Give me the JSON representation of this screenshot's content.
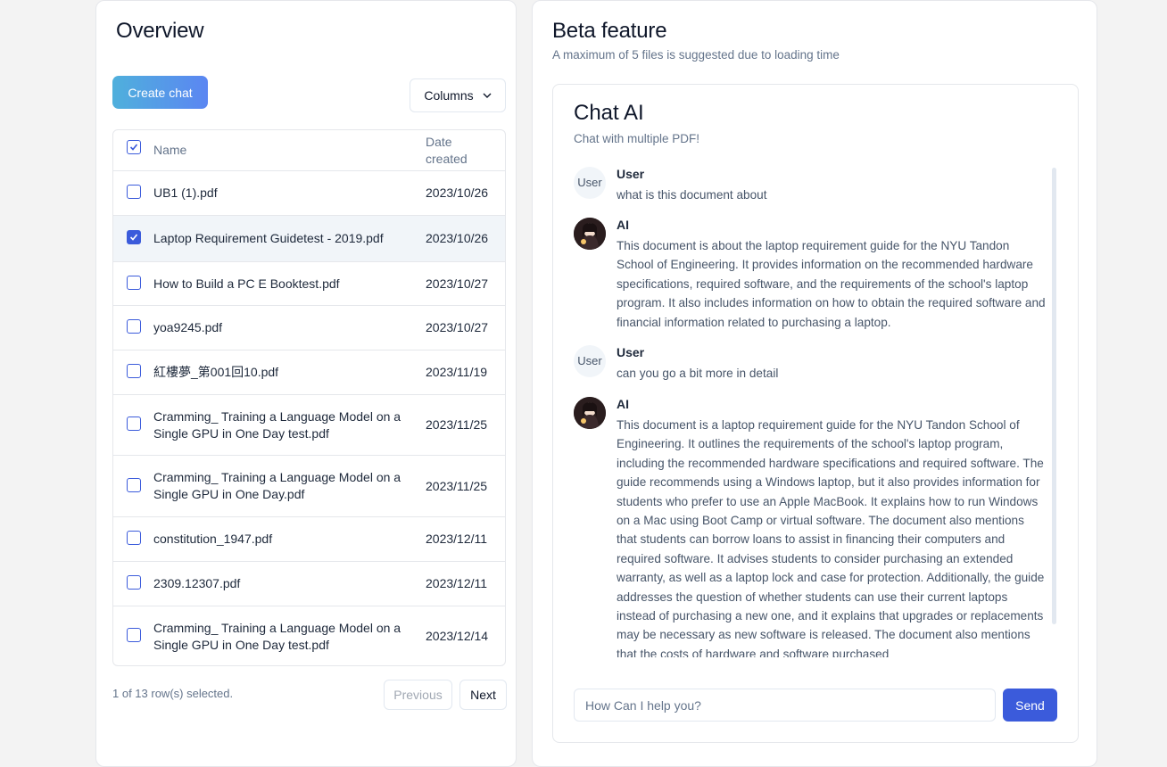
{
  "overview": {
    "title": "Overview",
    "create_chat_label": "Create chat",
    "columns_label": "Columns",
    "table": {
      "headers": {
        "name": "Name",
        "date_line1": "Date",
        "date_line2": "created"
      },
      "rows": [
        {
          "name": "UB1 (1).pdf",
          "date": "2023/10/26",
          "checked": false
        },
        {
          "name": "Laptop Requirement Guidetest - 2019.pdf",
          "date": "2023/10/26",
          "checked": true
        },
        {
          "name": "How to Build a PC E Booktest.pdf",
          "date": "2023/10/27",
          "checked": false
        },
        {
          "name": "yoa9245.pdf",
          "date": "2023/10/27",
          "checked": false
        },
        {
          "name": "紅樓夢_第001回10.pdf",
          "date": "2023/11/19",
          "checked": false
        },
        {
          "name": "Cramming_ Training a Language Model on a Single GPU in One Day test.pdf",
          "date": "2023/11/25",
          "checked": false
        },
        {
          "name": "Cramming_ Training a Language Model on a Single GPU in One Day.pdf",
          "date": "2023/11/25",
          "checked": false
        },
        {
          "name": "constitution_1947.pdf",
          "date": "2023/12/11",
          "checked": false
        },
        {
          "name": "2309.12307.pdf",
          "date": "2023/12/11",
          "checked": false
        },
        {
          "name": "Cramming_ Training a Language Model on a Single GPU in One Day test.pdf",
          "date": "2023/12/14",
          "checked": false
        }
      ]
    },
    "selection_status": "1 of 13 row(s) selected.",
    "prev_label": "Previous",
    "next_label": "Next"
  },
  "beta": {
    "title": "Beta feature",
    "subtitle": "A maximum of 5 files is suggested due to loading time",
    "chat": {
      "title": "Chat AI",
      "subtitle": "Chat with multiple PDF!",
      "messages": [
        {
          "role": "user",
          "avatar_text": "User",
          "author": "User",
          "text": "what is this document about"
        },
        {
          "role": "ai",
          "author": "AI",
          "text": "This document is about the laptop requirement guide for the NYU Tandon School of Engineering. It provides information on the recommended hardware specifications, required software, and the requirements of the school's laptop program. It also includes information on how to obtain the required software and financial information related to purchasing a laptop."
        },
        {
          "role": "user",
          "avatar_text": "User",
          "author": "User",
          "text": "can you go a bit more in detail"
        },
        {
          "role": "ai",
          "author": "AI",
          "text": "This document is a laptop requirement guide for the NYU Tandon School of Engineering. It outlines the requirements of the school's laptop program, including the recommended hardware specifications and required software. The guide recommends using a Windows laptop, but it also provides information for students who prefer to use an Apple MacBook. It explains how to run Windows on a Mac using Boot Camp or virtual software. The document also mentions that students can borrow loans to assist in financing their computers and required software. It advises students to consider purchasing an extended warranty, as well as a laptop lock and case for protection. Additionally, the guide addresses the question of whether students can use their current laptops instead of purchasing a new one, and it explains that upgrades or replacements may be necessary as new software is released. The document also mentions that the costs of hardware and software purchased"
        }
      ],
      "input_placeholder": "How Can I help you?",
      "send_label": "Send"
    }
  },
  "colors": {
    "accent": "#3b5bdb",
    "gradient_start": "#4fb0dc",
    "gradient_end": "#5b86f2"
  }
}
